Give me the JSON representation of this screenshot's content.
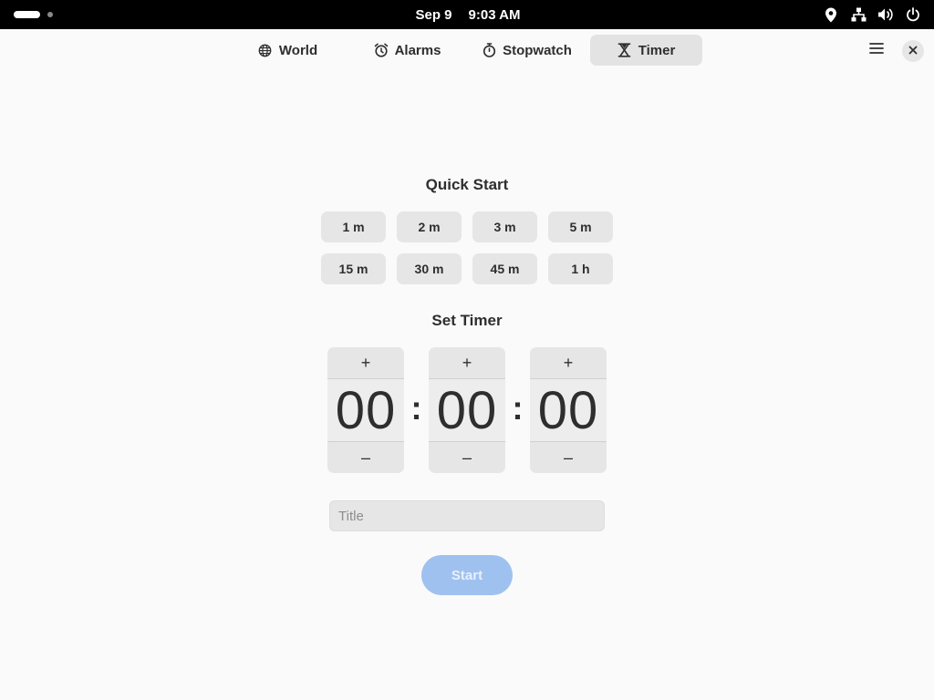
{
  "system_bar": {
    "date": "Sep 9",
    "time": "9:03 AM",
    "tray_icons": [
      "location-icon",
      "network-icon",
      "volume-icon",
      "power-icon"
    ]
  },
  "header": {
    "tabs": [
      {
        "label": "World",
        "icon": "globe-icon",
        "active": false
      },
      {
        "label": "Alarms",
        "icon": "alarm-clock-icon",
        "active": false
      },
      {
        "label": "Stopwatch",
        "icon": "stopwatch-icon",
        "active": false
      },
      {
        "label": "Timer",
        "icon": "hourglass-icon",
        "active": true
      }
    ],
    "menu_icon": "hamburger-menu-icon",
    "close_icon": "close-icon"
  },
  "quick_start": {
    "title": "Quick Start",
    "buttons": [
      "1 m",
      "2 m",
      "3 m",
      "5 m",
      "15 m",
      "30 m",
      "45 m",
      "1 h"
    ]
  },
  "set_timer": {
    "title": "Set Timer",
    "hours": "00",
    "minutes": "00",
    "seconds": "00",
    "increment_label": "+",
    "decrement_label": "–",
    "separator": ":"
  },
  "title_field": {
    "placeholder": "Title",
    "value": ""
  },
  "start_button": {
    "label": "Start",
    "enabled": false
  },
  "colors": {
    "accent_disabled": "#9fc1ef",
    "background": "#fafafa",
    "button_bg": "#e6e6e6",
    "text": "#2e2e2e"
  }
}
